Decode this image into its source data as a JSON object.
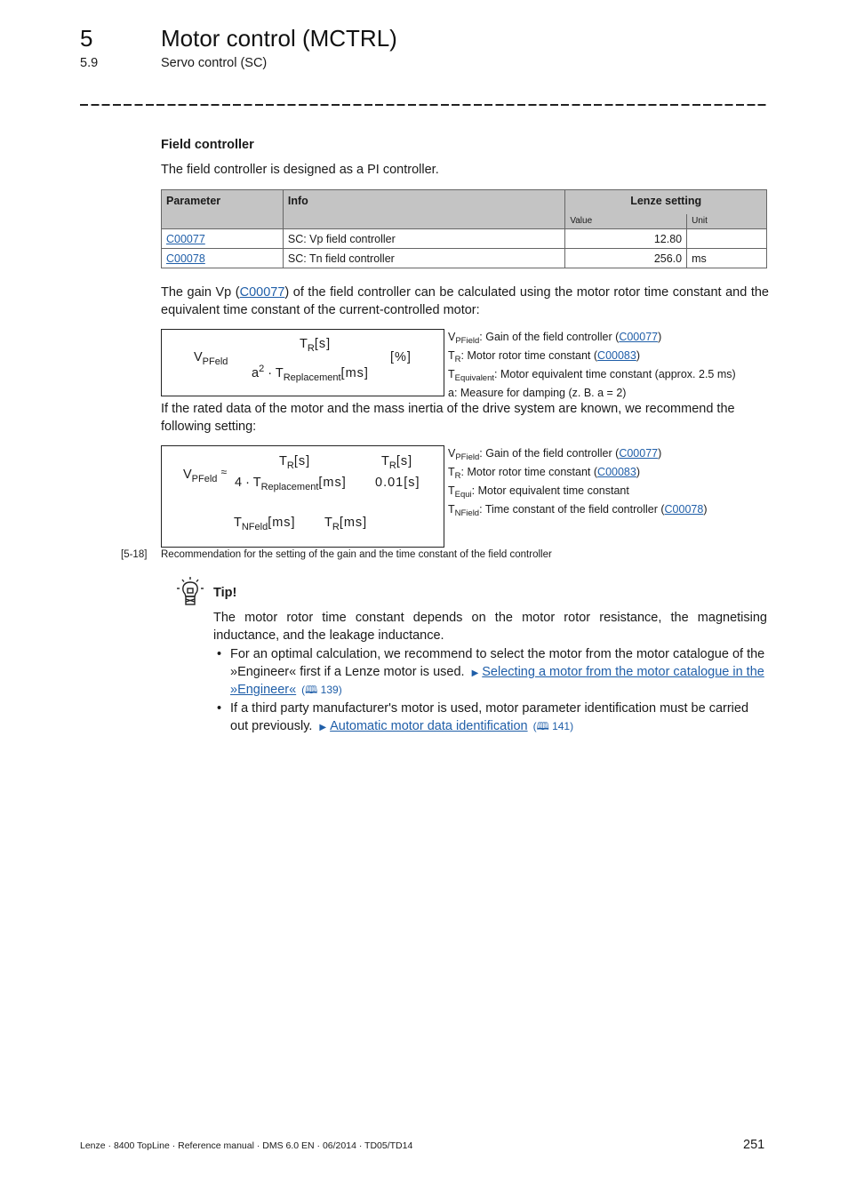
{
  "header": {
    "chapter_number": "5",
    "chapter_title": "Motor control (MCTRL)",
    "section_number": "5.9",
    "section_title": "Servo control (SC)"
  },
  "field_controller": {
    "heading": "Field controller",
    "intro": "The field controller is designed as a PI controller."
  },
  "table": {
    "headers": {
      "parameter": "Parameter",
      "info": "Info",
      "lenze_setting": "Lenze setting",
      "value": "Value",
      "unit": "Unit"
    },
    "rows": [
      {
        "parameter": "C00077",
        "info": "SC: Vp field controller",
        "value": "12.80",
        "unit": ""
      },
      {
        "parameter": "C00078",
        "info": "SC: Tn field controller",
        "value": "256.0",
        "unit": "ms"
      }
    ]
  },
  "paragraph_gain": {
    "before_link": "The gain Vp (",
    "link": "C00077",
    "after_link": ") of the field controller can be calculated using the motor rotor time constant and the equivalent time constant of the current-controlled motor:"
  },
  "formula1": {
    "lhs": "V",
    "lhs_sub": "PFeld",
    "num": "T",
    "num_sub": "R",
    "num_unit": "[s]",
    "den_a": "a",
    "den_exp": "2",
    "den_dot": "·",
    "den_T": "T",
    "den_sub": "Replacement",
    "den_unit": "[ms]",
    "unit": "[%]"
  },
  "legend1": [
    {
      "sym": "V",
      "sub": "PField",
      "text": ": Gain of the field controller (",
      "link": "C00077",
      "tail": ")"
    },
    {
      "sym": "T",
      "sub": "R",
      "text": ": Motor rotor time constant (",
      "link": "C00083",
      "tail": ")"
    },
    {
      "sym": "T",
      "sub": "Equivalent",
      "text": ": Motor equivalent time constant (approx. 2.5 ms)",
      "link": "",
      "tail": ""
    },
    {
      "sym": "a",
      "sub": "",
      "text": ": Measure for damping (z. B. a = 2)",
      "link": "",
      "tail": ""
    }
  ],
  "paragraph_recommend": "If the rated data of the motor and the mass inertia of the drive system are known, we recommend the following setting:",
  "formula2": {
    "lhs": "V",
    "lhs_sub": "PFeld",
    "approx": "≈",
    "num1_T": "T",
    "num1_sub": "R",
    "num1_unit": "[s]",
    "den1_four": "4 ·",
    "den1_T": "T",
    "den1_sub": "Replacement",
    "den1_unit": "[ms]",
    "num2_T": "T",
    "num2_sub": "R",
    "num2_unit": "[s]",
    "den2": "0.01[s]",
    "tn_T": "T",
    "tn_sub": "NFeld",
    "tn_unit": "[ms]",
    "tr_T": "T",
    "tr_sub": "R",
    "tr_unit": "[ms]"
  },
  "legend2": [
    {
      "sym": "V",
      "sub": "PField",
      "text": ": Gain of the field controller (",
      "link": "C00077",
      "tail": ")"
    },
    {
      "sym": "T",
      "sub": "R",
      "text": ": Motor rotor time constant (",
      "link": "C00083",
      "tail": ")"
    },
    {
      "sym": "T",
      "sub": "Equi",
      "text": ": Motor equivalent time constant",
      "link": "",
      "tail": ""
    },
    {
      "sym": "T",
      "sub": "NField",
      "text": ": Time constant of the field controller (",
      "link": "C00078",
      "tail": ")"
    }
  ],
  "caption": {
    "number": "[5-18]",
    "text": "Recommendation for the setting of the gain and the time constant of the field controller"
  },
  "tip": {
    "icon": "lightbulb-icon",
    "label": "Tip!",
    "body": "The motor rotor time constant depends on the motor rotor resistance, the magnetising inductance, and the leakage inductance.",
    "bullets": [
      {
        "text": "For an optimal calculation, we recommend to select the motor from the motor catalogue of the »Engineer« first if a Lenze motor is used.",
        "link": "Selecting a motor from the motor catalogue in the »Engineer«",
        "page": "139"
      },
      {
        "text": "If a third party manufacturer's motor is used, motor parameter identification must be carried out previously.",
        "link": "Automatic motor data identification",
        "page": "141"
      }
    ]
  },
  "footer": {
    "text": "Lenze · 8400 TopLine · Reference manual · DMS 6.0 EN · 06/2014 · TD05/TD14",
    "page_number": "251"
  }
}
